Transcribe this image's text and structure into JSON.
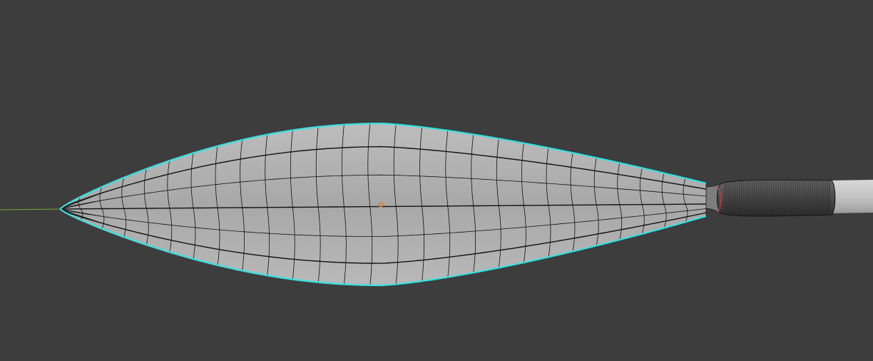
{
  "viewport": {
    "background_color": "#3d3d3d",
    "view": "3d-mesh-edit-viewport"
  },
  "mesh": {
    "object": "leaf-blade",
    "shape": "lens",
    "shading": "solid",
    "surface_color": "#b4b4b4",
    "wireframe_color": "#111111",
    "selection_outline_color": "#36e0e0",
    "seam_color": "#d23c3c",
    "horizontal_edge_loops": 5,
    "vertical_edge_loops": 27
  },
  "stem": {
    "grip_color": "#4a4a4a",
    "shaft_color": "#c9c9c9"
  },
  "scene_markers": {
    "origin_color": "#e07a1a",
    "x_axis_color": "#7ca832"
  }
}
